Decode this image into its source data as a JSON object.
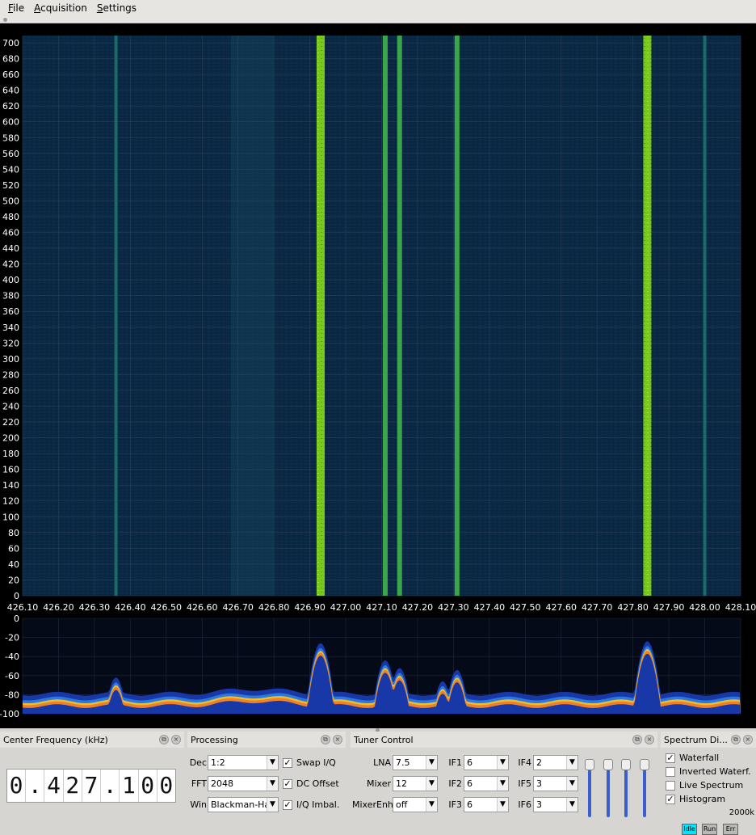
{
  "menu": {
    "file": "File",
    "acquisition": "Acquisition",
    "settings": "Settings"
  },
  "waterfall": {
    "y_ticks": [
      "700",
      "680",
      "660",
      "640",
      "620",
      "600",
      "580",
      "560",
      "540",
      "520",
      "500",
      "480",
      "460",
      "440",
      "420",
      "400",
      "380",
      "360",
      "340",
      "320",
      "300",
      "280",
      "260",
      "240",
      "220",
      "200",
      "180",
      "160",
      "140",
      "120",
      "100",
      "80",
      "60",
      "40",
      "20",
      "0"
    ],
    "x_ticks": [
      "426.10",
      "426.20",
      "426.30",
      "426.40",
      "426.50",
      "426.60",
      "426.70",
      "426.80",
      "426.90",
      "427.00",
      "427.10",
      "427.20",
      "427.30",
      "427.40",
      "427.50",
      "427.60",
      "427.70",
      "427.80",
      "427.90",
      "428.00",
      "428.10"
    ],
    "strong_signals_mhz": [
      426.93,
      427.84
    ],
    "medium_signals_mhz": [
      427.11,
      427.15,
      427.31
    ],
    "weak_signals_mhz": [
      426.36,
      428.0
    ],
    "colors": {
      "background": "#0a2440",
      "strong": "#7ed321",
      "medium": "#3aa54a",
      "weak": "#1a6a6a"
    }
  },
  "spectrum": {
    "y_ticks": [
      "0",
      "-20",
      "-40",
      "-60",
      "-80",
      "-100"
    ],
    "y_range_db": [
      -100,
      0
    ],
    "noise_floor_db": -85,
    "peaks": [
      {
        "freq_mhz": 426.36,
        "db": -68
      },
      {
        "freq_mhz": 426.93,
        "db": -32
      },
      {
        "freq_mhz": 427.11,
        "db": -50
      },
      {
        "freq_mhz": 427.15,
        "db": -58
      },
      {
        "freq_mhz": 427.27,
        "db": -72
      },
      {
        "freq_mhz": 427.31,
        "db": -60
      },
      {
        "freq_mhz": 427.84,
        "db": -30
      }
    ]
  },
  "center_frequency": {
    "title": "Center Frequency (kHz)",
    "digits": [
      "0",
      ".",
      "4",
      "2",
      "7",
      ".",
      "1",
      "0",
      "0"
    ]
  },
  "processing": {
    "title": "Processing",
    "dec_label": "Dec",
    "dec_value": "1:2",
    "fft_label": "FFT",
    "fft_value": "2048",
    "win_label": "Win",
    "win_value": "Blackman-Hai",
    "swap_iq": "Swap I/Q",
    "dc_offset": "DC Offset",
    "iq_imbal": "I/Q Imbal."
  },
  "tuner": {
    "title": "Tuner Control",
    "lna_label": "LNA",
    "lna_value": "7.5",
    "mixer_label": "Mixer",
    "mixer_value": "12",
    "mixerenh_label": "MixerEnh",
    "mixerenh_value": "off",
    "if1_label": "IF1",
    "if1_value": "6",
    "if2_label": "IF2",
    "if2_value": "6",
    "if3_label": "IF3",
    "if3_value": "6",
    "if4_label": "IF4",
    "if4_value": "2",
    "if5_label": "IF5",
    "if5_value": "3",
    "if6_label": "IF6",
    "if6_value": "3"
  },
  "spectrum_display": {
    "title": "Spectrum Di...",
    "waterfall": "Waterfall",
    "inverted": "Inverted Waterf.",
    "live": "Live Spectrum",
    "histogram": "Histogram",
    "rate": "2000k",
    "idle": "Idle",
    "run": "Run",
    "err": "Err"
  }
}
